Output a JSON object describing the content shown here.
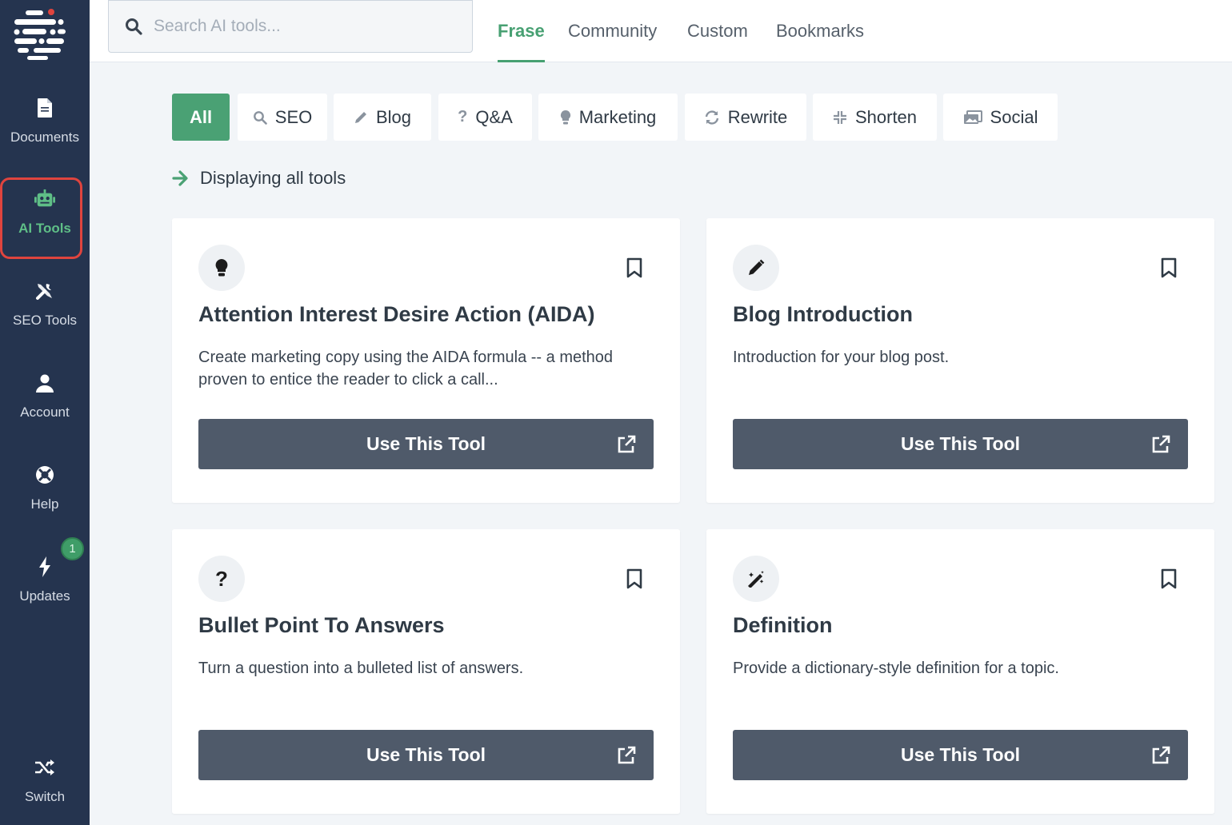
{
  "sidebar": {
    "items": [
      {
        "label": "Documents",
        "icon": "document-icon"
      },
      {
        "label": "AI Tools",
        "icon": "robot-icon",
        "active": true
      },
      {
        "label": "SEO Tools",
        "icon": "tools-icon"
      },
      {
        "label": "Account",
        "icon": "user-icon"
      },
      {
        "label": "Help",
        "icon": "lifebuoy-icon"
      },
      {
        "label": "Updates",
        "icon": "bolt-icon"
      },
      {
        "label": "Switch",
        "icon": "shuffle-icon"
      }
    ],
    "updates_badge": "1"
  },
  "search": {
    "placeholder": "Search AI tools..."
  },
  "tabs": [
    {
      "label": "Frase",
      "active": true
    },
    {
      "label": "Community"
    },
    {
      "label": "Custom"
    },
    {
      "label": "Bookmarks"
    }
  ],
  "filters": [
    {
      "label": "All",
      "active": true
    },
    {
      "label": "SEO",
      "icon": "search-icon"
    },
    {
      "label": "Blog",
      "icon": "pencil-icon"
    },
    {
      "label": "Q&A",
      "icon": "question-icon"
    },
    {
      "label": "Marketing",
      "icon": "lightbulb-icon"
    },
    {
      "label": "Rewrite",
      "icon": "refresh-icon"
    },
    {
      "label": "Shorten",
      "icon": "compress-icon"
    },
    {
      "label": "Social",
      "icon": "images-icon"
    }
  ],
  "display_note": "Displaying all tools",
  "cards": [
    {
      "title": "Attention Interest Desire Action (AIDA)",
      "description": "Create marketing copy using the AIDA formula -- a method proven to entice the reader to click a call...",
      "button": "Use This Tool",
      "icon": "lightbulb-icon"
    },
    {
      "title": "Blog Introduction",
      "description": "Introduction for your blog post.",
      "button": "Use This Tool",
      "icon": "pencil-icon"
    },
    {
      "title": "Bullet Point To Answers",
      "description": "Turn a question into a bulleted list of answers.",
      "button": "Use This Tool",
      "icon": "question-icon"
    },
    {
      "title": "Definition",
      "description": "Provide a dictionary-style definition for a topic.",
      "button": "Use This Tool",
      "icon": "magic-wand-icon"
    }
  ],
  "colors": {
    "sidebar": "#25344f",
    "accent": "#4aa174",
    "button": "#4f5a6a",
    "active_ring": "#e0443e"
  }
}
